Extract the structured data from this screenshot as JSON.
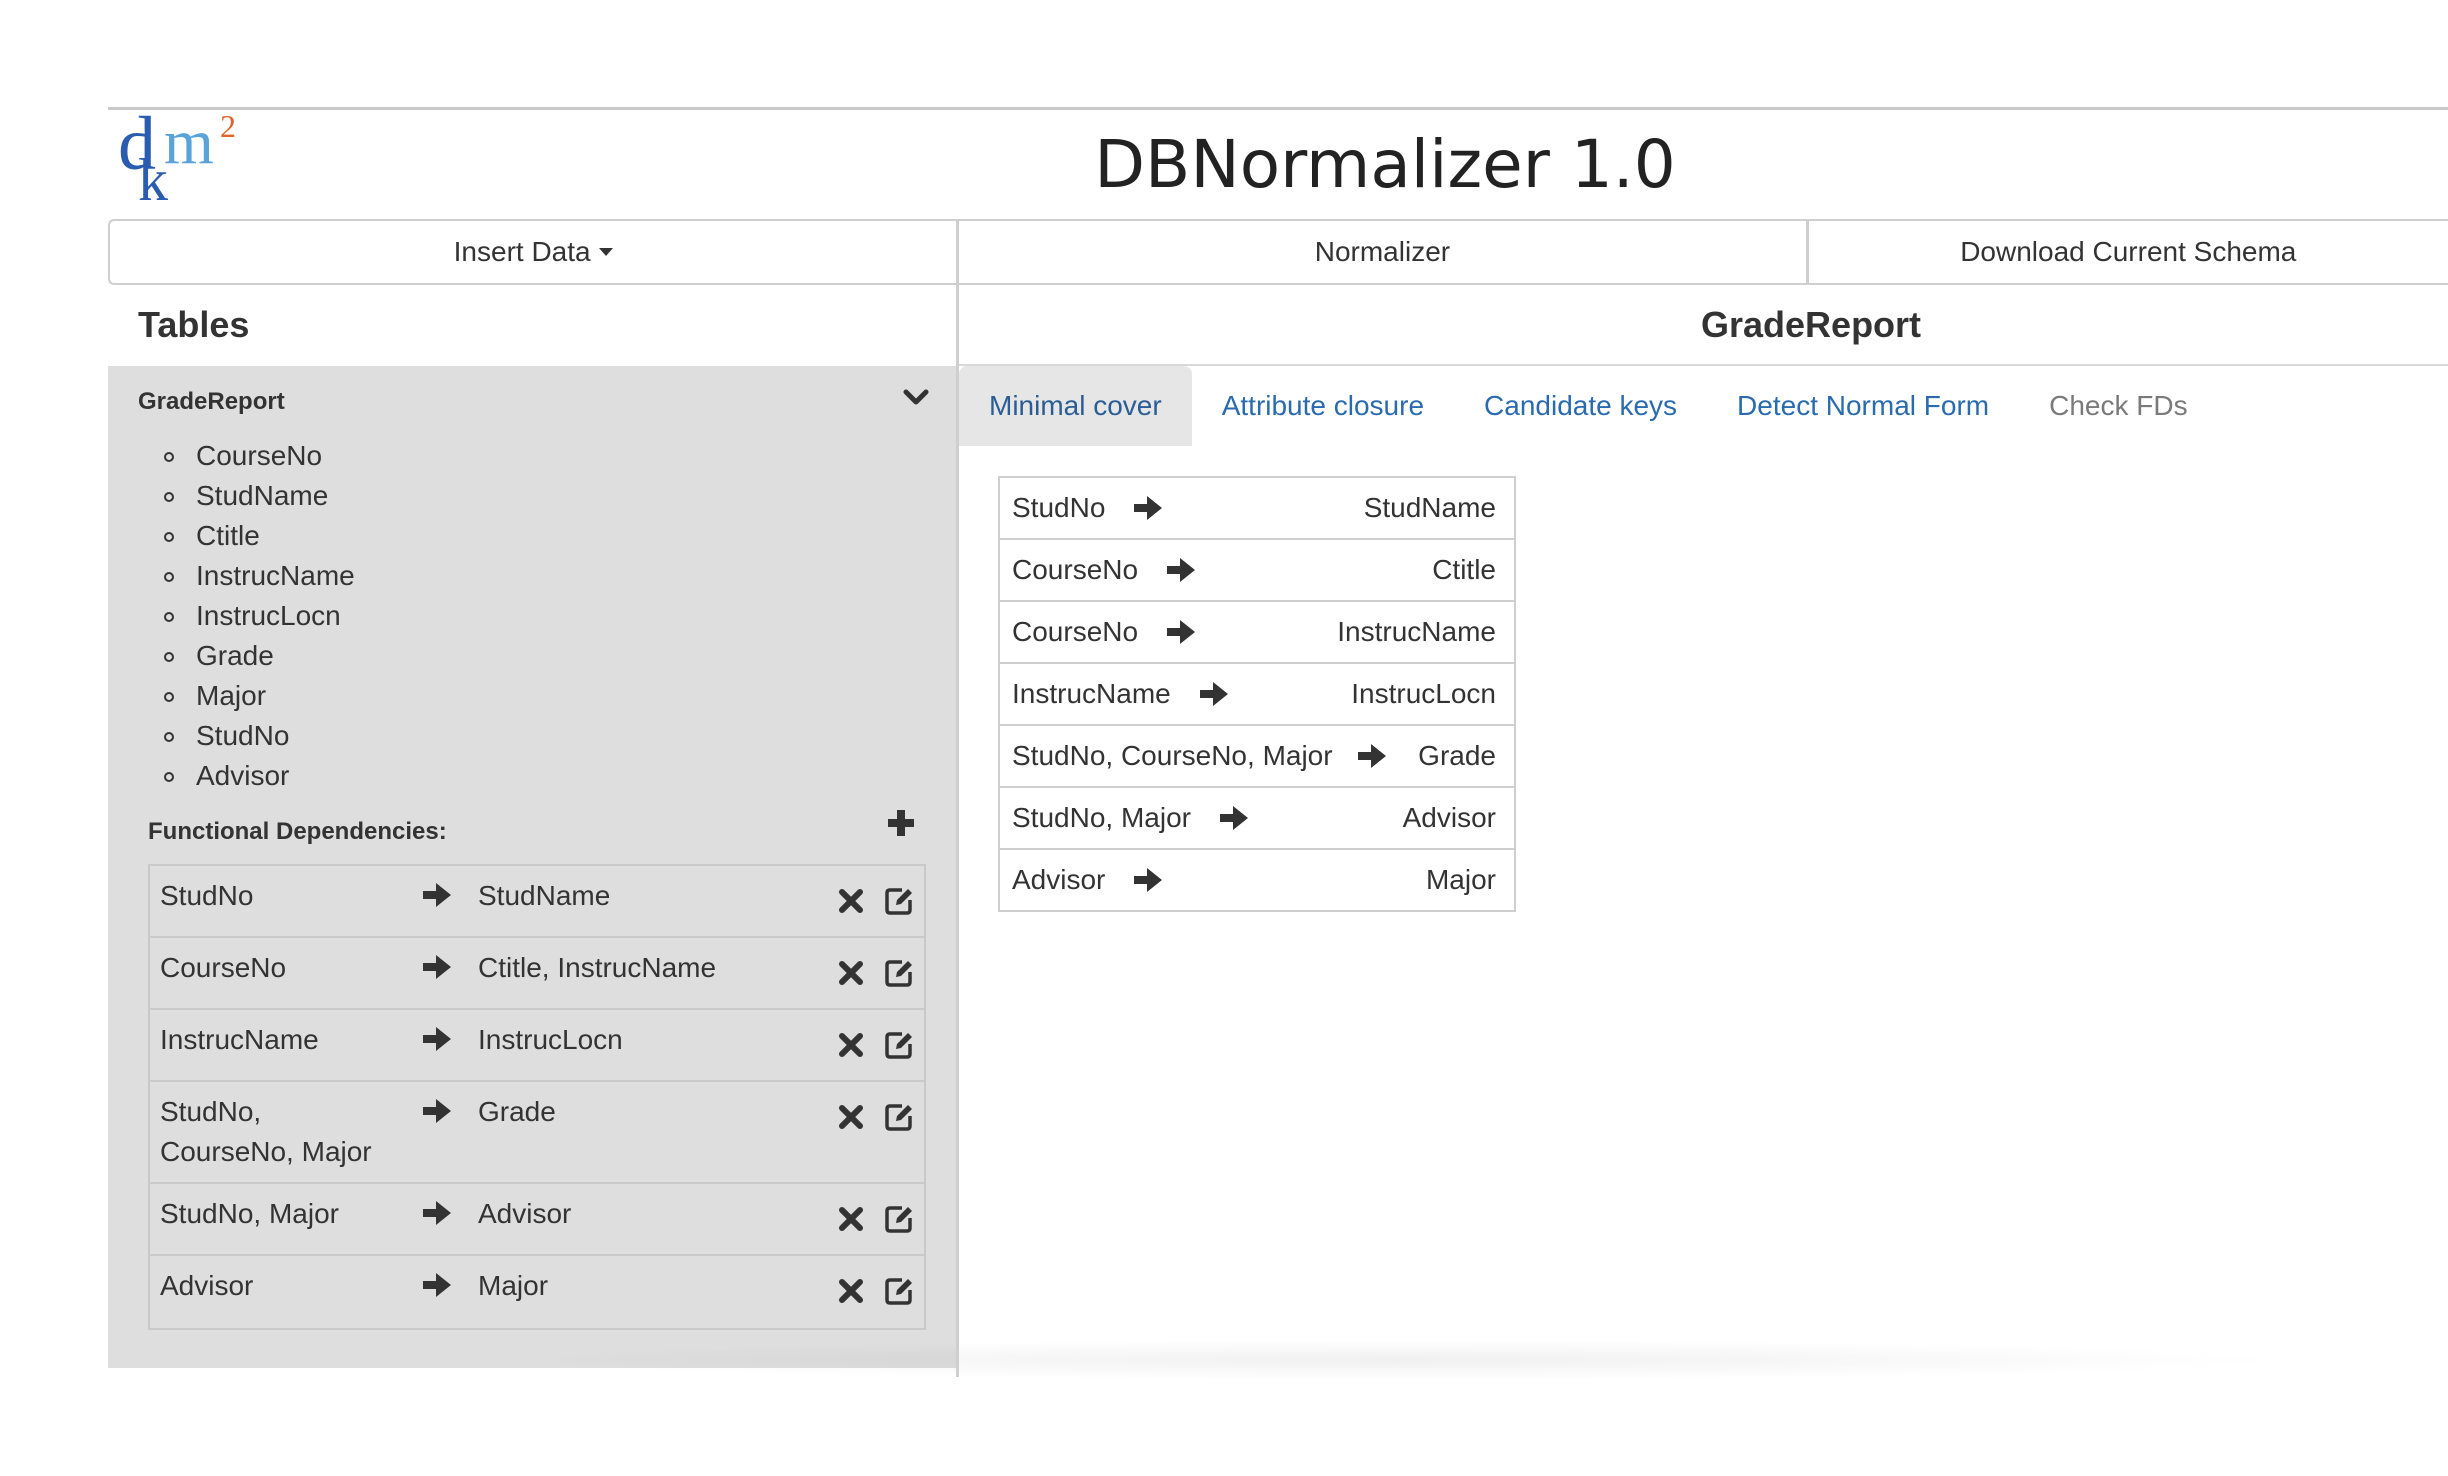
{
  "app": {
    "title": "DBNormalizer 1.0",
    "logo": {
      "d": "d",
      "k": "k",
      "m": "m",
      "sup": "2"
    }
  },
  "nav": {
    "insert_data": "Insert Data",
    "normalizer": "Normalizer",
    "download": "Download Current Schema"
  },
  "left": {
    "title": "Tables",
    "table_name": "GradeReport",
    "attributes": [
      "CourseNo",
      "StudName",
      "Ctitle",
      "InstrucName",
      "InstrucLocn",
      "Grade",
      "Major",
      "StudNo",
      "Advisor"
    ],
    "fd_label": "Functional Dependencies:",
    "fds": [
      {
        "lhs": "StudNo",
        "rhs": "StudName"
      },
      {
        "lhs": "CourseNo",
        "rhs": "Ctitle, InstrucName"
      },
      {
        "lhs": "InstrucName",
        "rhs": "InstrucLocn"
      },
      {
        "lhs": "StudNo, CourseNo, Major",
        "rhs": "Grade"
      },
      {
        "lhs": "StudNo, Major",
        "rhs": "Advisor"
      },
      {
        "lhs": "Advisor",
        "rhs": "Major"
      }
    ]
  },
  "right": {
    "title": "GradeReport",
    "tabs": [
      "Minimal cover",
      "Attribute closure",
      "Candidate keys",
      "Detect Normal Form",
      "Check FDs"
    ],
    "active_tab": "Minimal cover",
    "minimal_cover": [
      {
        "lhs": "StudNo",
        "rhs": "StudName"
      },
      {
        "lhs": "CourseNo",
        "rhs": "Ctitle"
      },
      {
        "lhs": "CourseNo",
        "rhs": "InstrucName"
      },
      {
        "lhs": "InstrucName",
        "rhs": "InstrucLocn"
      },
      {
        "lhs": "StudNo, CourseNo, Major",
        "rhs": "Grade"
      },
      {
        "lhs": "StudNo, Major",
        "rhs": "Advisor"
      },
      {
        "lhs": "Advisor",
        "rhs": "Major"
      }
    ]
  },
  "icons": {
    "arrow": "arrow-right-icon",
    "delete": "times-icon",
    "edit": "edit-icon",
    "add": "plus-icon",
    "collapse": "chevron-down-icon"
  },
  "colors": {
    "link": "#2a6bb0",
    "panel_bg": "#dedede",
    "active_tab_bg": "#e6e6e6",
    "logo_blue": "#2a5db0",
    "logo_light_blue": "#5aa3d8",
    "logo_orange": "#e0652a"
  }
}
